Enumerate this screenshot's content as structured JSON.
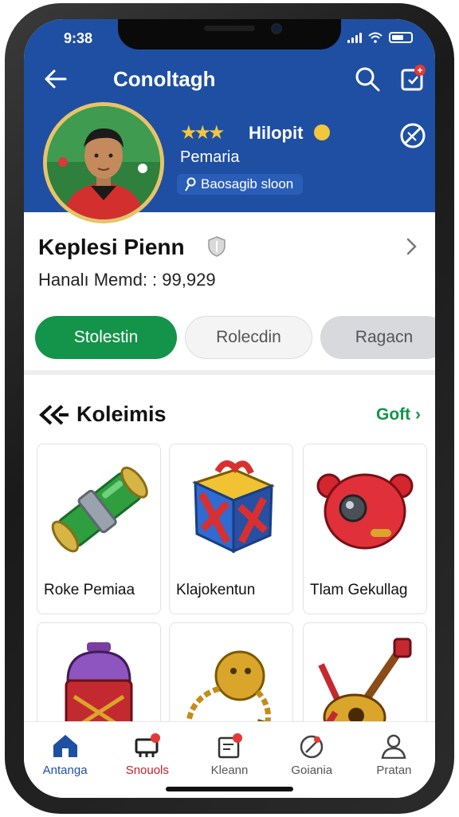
{
  "status_bar": {
    "time": "9:38"
  },
  "header": {
    "title": "Conoltagh",
    "username": "Hilopit",
    "subtitle": "Pemaria",
    "pill_text": "Baosagib sloon"
  },
  "player": {
    "name": "Keplesi Pienn",
    "meta": "Hanalı Memd: : 99,929"
  },
  "actions": {
    "primary": "Stolestin",
    "secondary": "Rolecdin",
    "tertiary": "Ragacn"
  },
  "collection": {
    "title": "Koleimis",
    "link": "Goft",
    "items": [
      {
        "label": "Roke Pemiaa",
        "icon": "green-tube-icon"
      },
      {
        "label": "Klajokentun",
        "icon": "treasure-box-icon"
      },
      {
        "label": "Tlam Gekullag",
        "icon": "red-robot-icon"
      },
      {
        "label": "",
        "icon": "lantern-icon"
      },
      {
        "label": "",
        "icon": "golden-chain-icon"
      },
      {
        "label": "",
        "icon": "guitar-icon"
      }
    ]
  },
  "tabs": [
    {
      "label": "Antanga",
      "icon": "home-icon"
    },
    {
      "label": "Snouols",
      "icon": "shop-icon"
    },
    {
      "label": "Kleann",
      "icon": "calendar-icon"
    },
    {
      "label": "Goiania",
      "icon": "compass-icon"
    },
    {
      "label": "Pratan",
      "icon": "profile-icon"
    }
  ],
  "colors": {
    "header_blue": "#1f4fa3",
    "primary_green": "#14934a",
    "star_gold": "#f3c63c"
  }
}
